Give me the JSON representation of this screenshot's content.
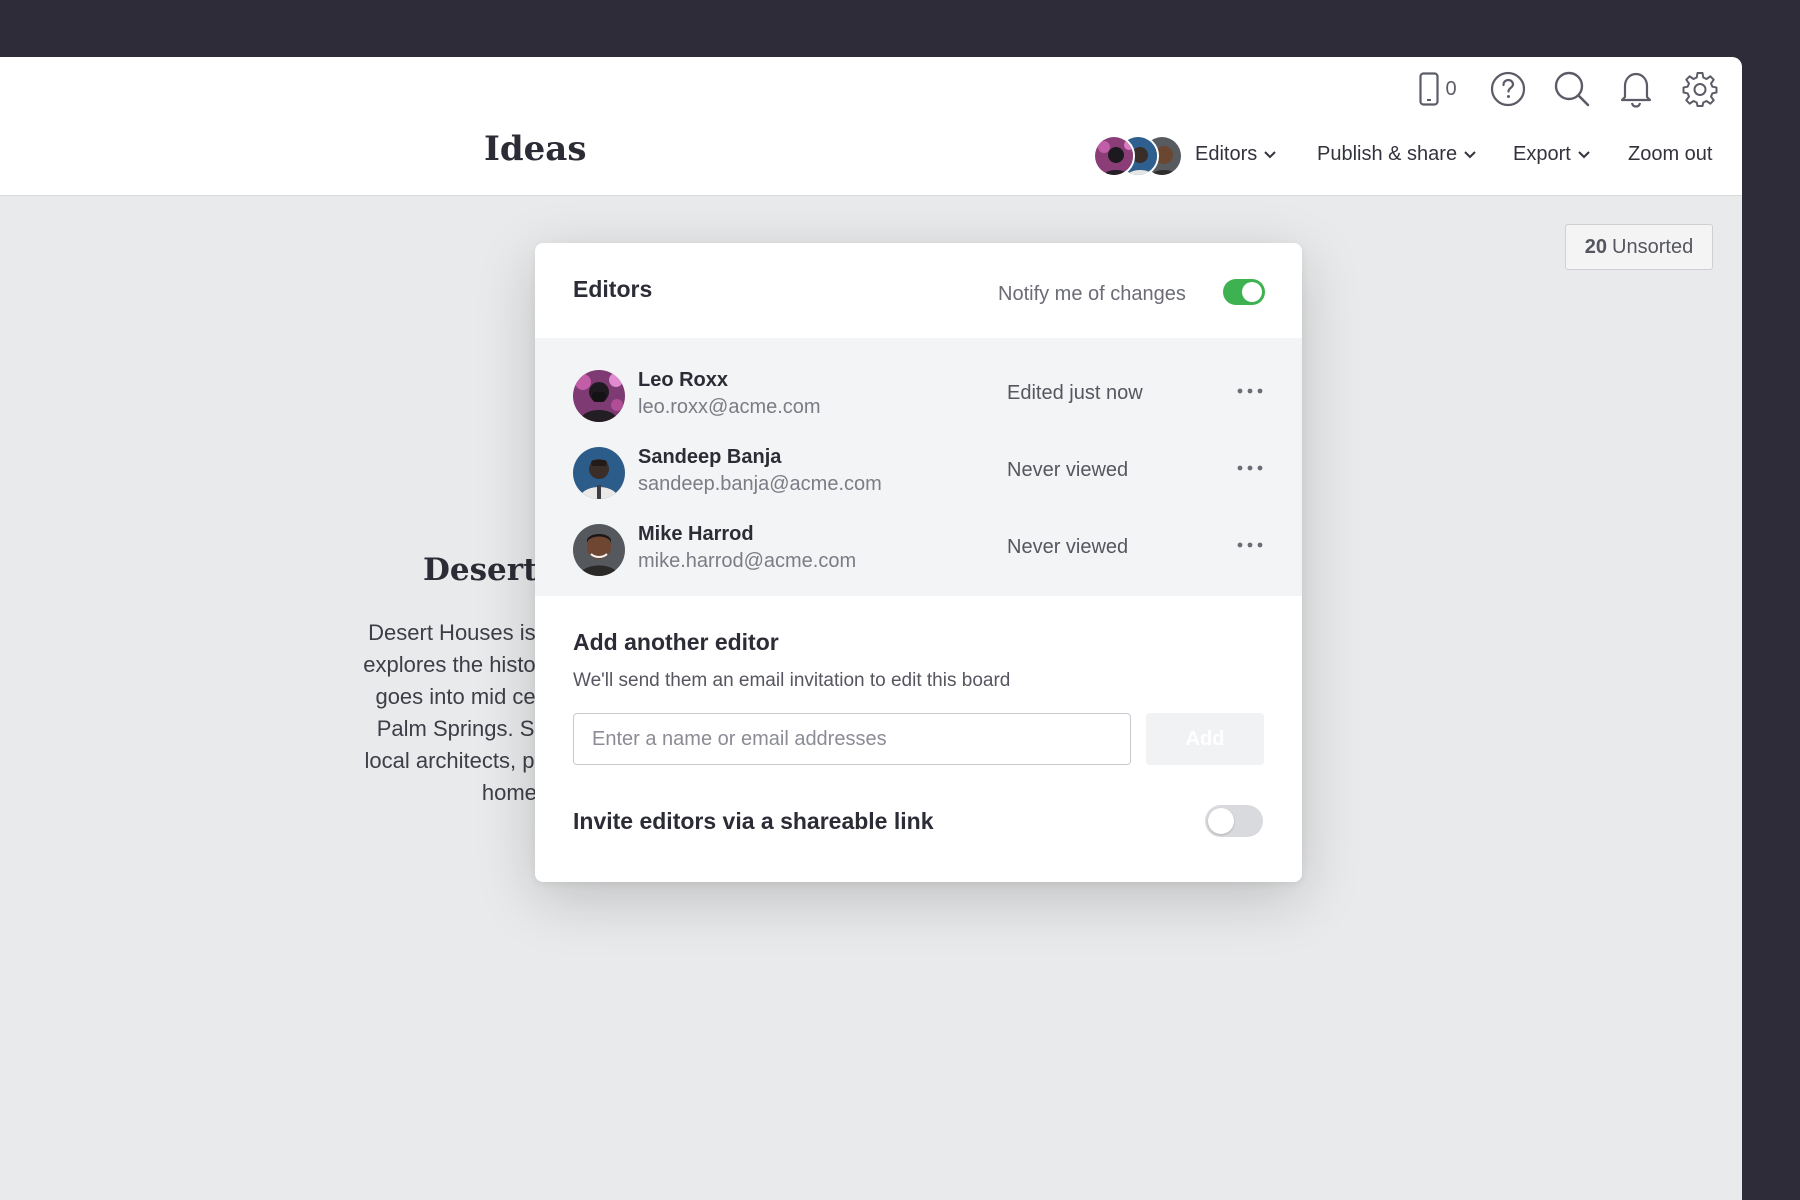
{
  "header": {
    "board_title": "Ideas",
    "phone_count": "0",
    "icons": [
      "phone-icon",
      "help-icon",
      "search-icon",
      "bell-icon",
      "gear-icon"
    ]
  },
  "nav": {
    "editors_label": "Editors",
    "publish_label": "Publish & share",
    "export_label": "Export",
    "zoom_label": "Zoom out"
  },
  "unsorted": {
    "count": "20",
    "label": "Unsorted"
  },
  "card": {
    "title": "Desert I",
    "body_lines": [
      "Desert Houses is a",
      "explores the history",
      "goes into mid cent",
      "Palm Springs. Sor",
      "local architects, pre",
      "home c"
    ]
  },
  "editors_panel": {
    "title": "Editors",
    "notify_label": "Notify me of changes",
    "notify_enabled": true,
    "editors": [
      {
        "name": "Leo Roxx",
        "email": "leo.roxx@acme.com",
        "status": "Edited just now"
      },
      {
        "name": "Sandeep Banja",
        "email": "sandeep.banja@acme.com",
        "status": "Never viewed"
      },
      {
        "name": "Mike Harrod",
        "email": "mike.harrod@acme.com",
        "status": "Never viewed"
      }
    ],
    "add": {
      "title": "Add another editor",
      "subtitle": "We'll send them an email invitation to edit this board",
      "placeholder": "Enter a name or email addresses",
      "button_label": "Add"
    },
    "invite_link_label": "Invite editors via a shareable link",
    "invite_link_enabled": false
  },
  "colors": {
    "background": "#2d2c38",
    "canvas": "#e9eaeb",
    "toggle_on": "#3eb250",
    "toggle_off": "#d9dadd"
  }
}
